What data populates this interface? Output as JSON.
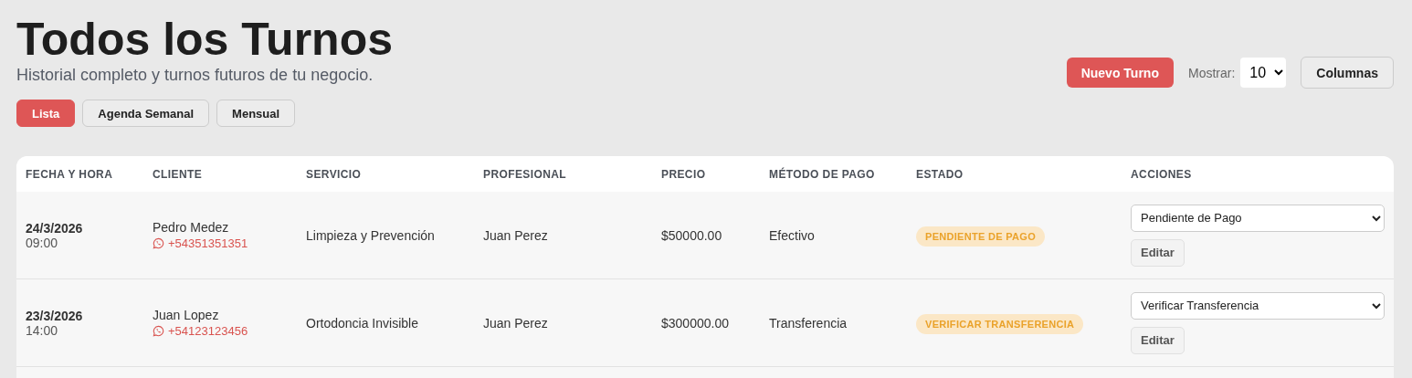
{
  "header": {
    "title": "Todos los Turnos",
    "subtitle": "Historial completo y turnos futuros de tu negocio."
  },
  "view_tabs": [
    {
      "label": "Lista",
      "selected": true
    },
    {
      "label": "Agenda Semanal",
      "selected": false
    },
    {
      "label": "Mensual",
      "selected": false
    }
  ],
  "toolbar": {
    "new_button": "Nuevo Turno",
    "show_label": "Mostrar:",
    "show_value": "10",
    "columns_button": "Columnas"
  },
  "table": {
    "columns": [
      "FECHA Y HORA",
      "CLIENTE",
      "SERVICIO",
      "PROFESIONAL",
      "PRECIO",
      "MÉTODO DE PAGO",
      "ESTADO",
      "ACCIONES"
    ],
    "rows": [
      {
        "date": "24/3/2026",
        "time": "09:00",
        "client": "Pedro Medez",
        "phone": "+54351351351",
        "service": "Limpieza y Prevención",
        "professional": "Juan Perez",
        "price": "$50000.00",
        "payment": "Efectivo",
        "status": "PENDIENTE DE PAGO",
        "status_select": "Pendiente de Pago",
        "edit": "Editar"
      },
      {
        "date": "23/3/2026",
        "time": "14:00",
        "client": "Juan Lopez",
        "phone": "+54123123456",
        "service": "Ortodoncia Invisible",
        "professional": "Juan Perez",
        "price": "$300000.00",
        "payment": "Transferencia",
        "status": "VERIFICAR TRANSFERENCIA",
        "status_select": "Verificar Transferencia",
        "edit": "Editar"
      }
    ]
  }
}
